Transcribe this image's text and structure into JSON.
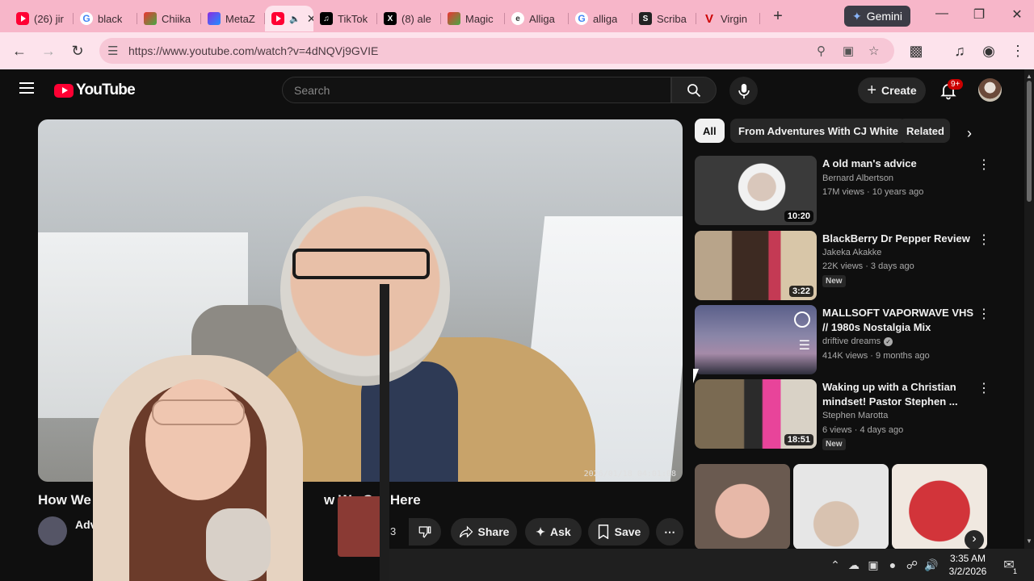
{
  "browser": {
    "tabs": [
      {
        "label": "(26) jir",
        "icon": "youtube-icon"
      },
      {
        "label": "black",
        "icon": "google-icon"
      },
      {
        "label": "Chiika",
        "icon": "magic-icon"
      },
      {
        "label": "MetaZ",
        "icon": "meta-icon"
      },
      {
        "label": "",
        "icon": "youtube-icon",
        "active": true
      },
      {
        "label": "TikTok",
        "icon": "tiktok-icon"
      },
      {
        "label": "(8) ale",
        "icon": "x-icon"
      },
      {
        "label": "Magic",
        "icon": "magic-icon"
      },
      {
        "label": "Alliga",
        "icon": "e-icon"
      },
      {
        "label": "alliga",
        "icon": "google-icon"
      },
      {
        "label": "Scriba",
        "icon": "scribd-icon"
      },
      {
        "label": "Virgin",
        "icon": "v-icon"
      }
    ],
    "gemini_label": "Gemini",
    "url": "https://www.youtube.com/watch?v=4dNQVj9GVIE",
    "colors": {
      "tabbar": "#f7b6c9",
      "toolbar": "#fde3ec"
    }
  },
  "youtube": {
    "logo_text": "YouTube",
    "search_placeholder": "Search",
    "create_label": "Create",
    "notification_badge": "9+",
    "video": {
      "title_left": "How We E",
      "title_right": "w We Got Here",
      "channel_name": "Adv",
      "like_count": "3",
      "overlay_timestamp": "2026/01/18 04:01:08",
      "actions": {
        "share": "Share",
        "ask": "Ask",
        "save": "Save"
      }
    },
    "chips": [
      "All",
      "From Adventures With CJ White",
      "Related"
    ],
    "recommendations": [
      {
        "title": "A old man's advice",
        "channel": "Bernard Albertson",
        "meta": "17M views · 10 years ago",
        "duration": "10:20",
        "new": ""
      },
      {
        "title": "BlackBerry Dr Pepper Review",
        "channel": "Jakeka Akakke",
        "meta": "22K views · 3 days ago",
        "duration": "3:22",
        "new": "New"
      },
      {
        "title": "MALLSOFT VAPORWAVE VHS // 1980s Nostalgia Mix",
        "channel": "driftive dreams",
        "meta": "414K views · 9 months ago",
        "duration": "",
        "new": ""
      },
      {
        "title": "Waking up with a Christian mindset! Pastor Stephen ...",
        "channel": "Stephen Marotta",
        "meta": "6 views · 4 days ago",
        "duration": "18:51",
        "new": "New"
      }
    ]
  },
  "taskbar": {
    "time": "3:35 AM",
    "date": "3/2/2026",
    "notification_count": "1"
  }
}
